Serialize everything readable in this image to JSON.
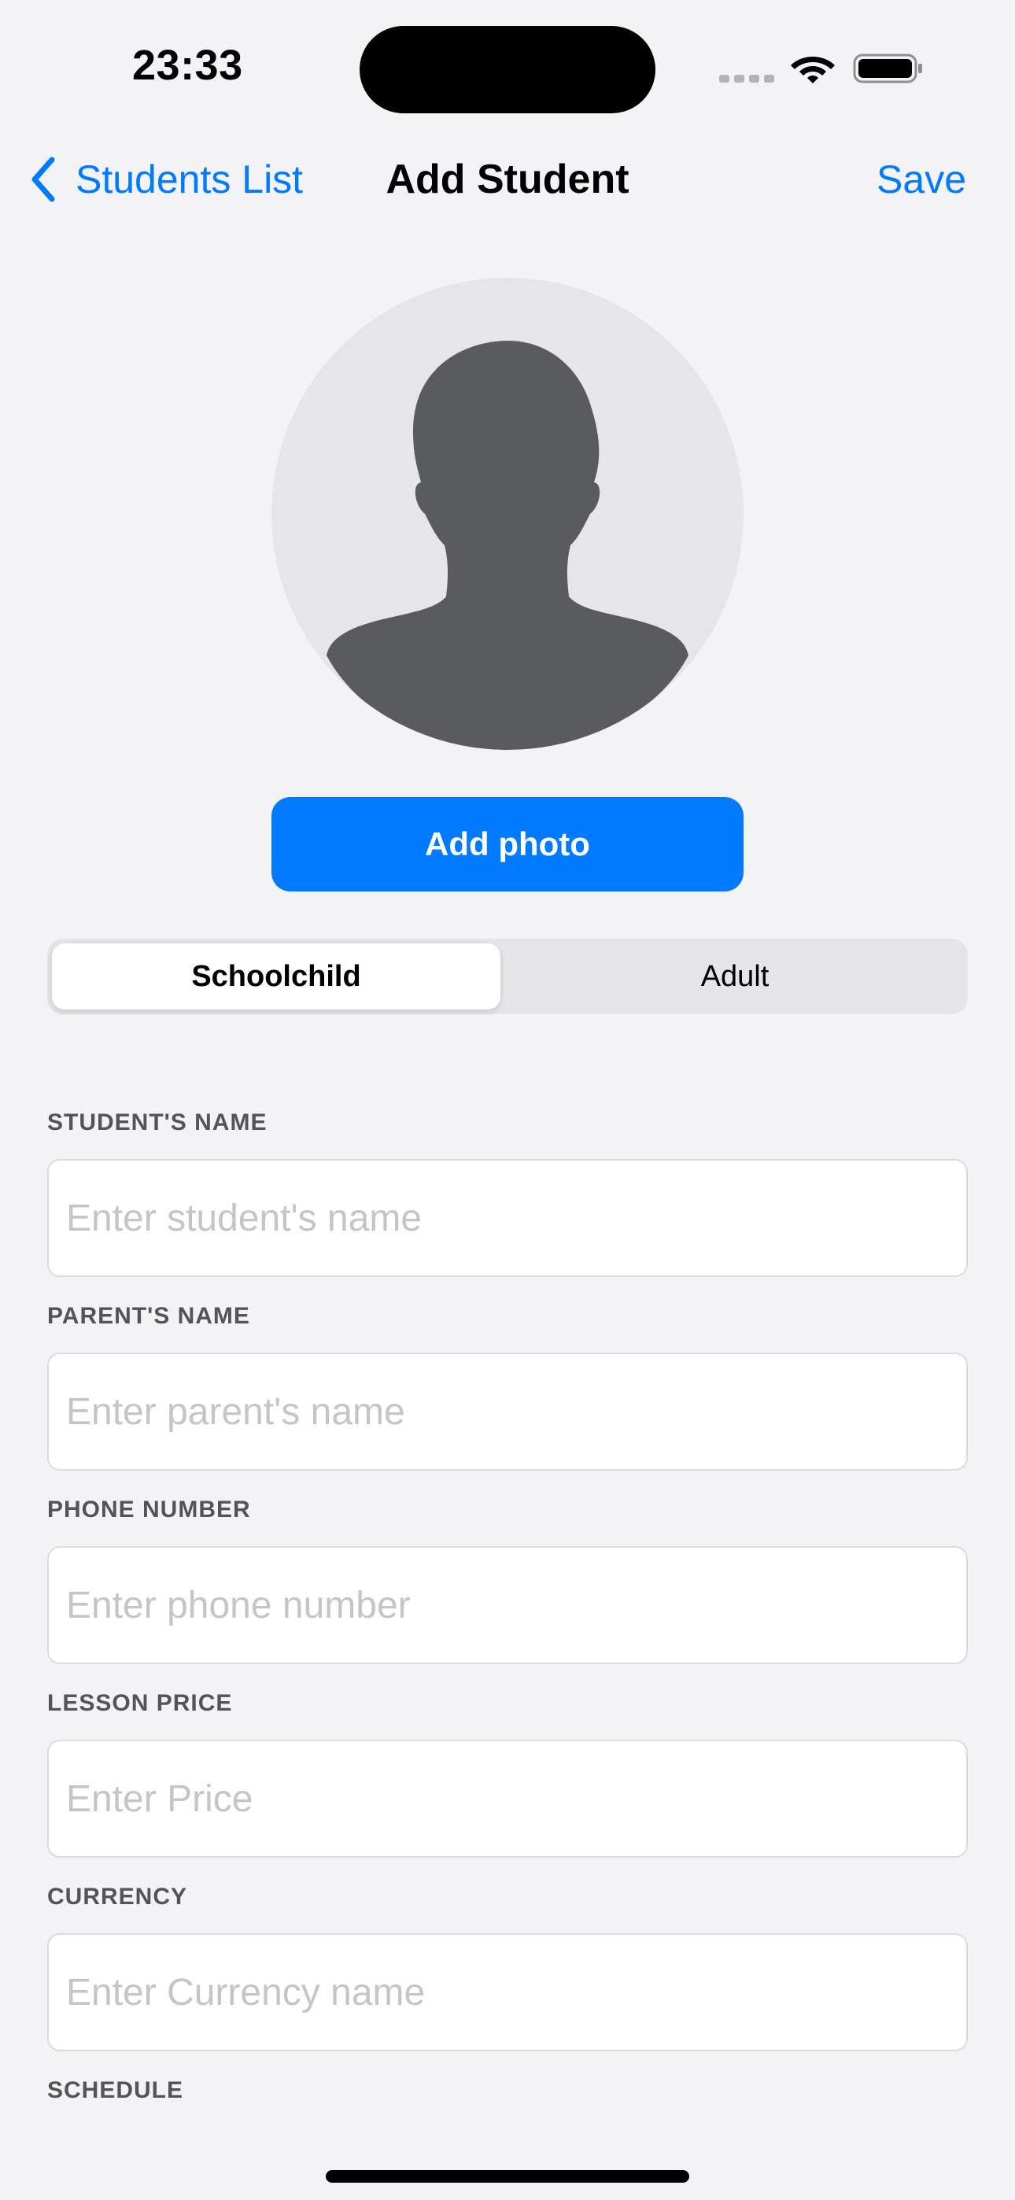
{
  "status_bar": {
    "time": "23:33"
  },
  "nav": {
    "back_label": "Students List",
    "title": "Add Student",
    "save_label": "Save"
  },
  "avatar": {
    "icon": "person-silhouette-icon"
  },
  "add_photo_label": "Add photo",
  "segmented": {
    "options": [
      "Schoolchild",
      "Adult"
    ],
    "selected": "Schoolchild"
  },
  "form": {
    "student_name": {
      "label": "STUDENT'S NAME",
      "placeholder": "Enter student's name",
      "value": ""
    },
    "parent_name": {
      "label": "PARENT'S NAME",
      "placeholder": "Enter parent's name",
      "value": ""
    },
    "phone": {
      "label": "PHONE NUMBER",
      "placeholder": "Enter phone number",
      "value": ""
    },
    "price": {
      "label": "LESSON PRICE",
      "placeholder": "Enter Price",
      "value": ""
    },
    "currency": {
      "label": "CURRENCY",
      "placeholder": "Enter Currency name",
      "value": ""
    },
    "schedule": {
      "label": "SCHEDULE"
    }
  },
  "colors": {
    "accent": "#007AFF",
    "background": "#F2F2F7",
    "avatar_bg": "#E5E5EA",
    "avatar_fg": "#5A5B5E"
  }
}
